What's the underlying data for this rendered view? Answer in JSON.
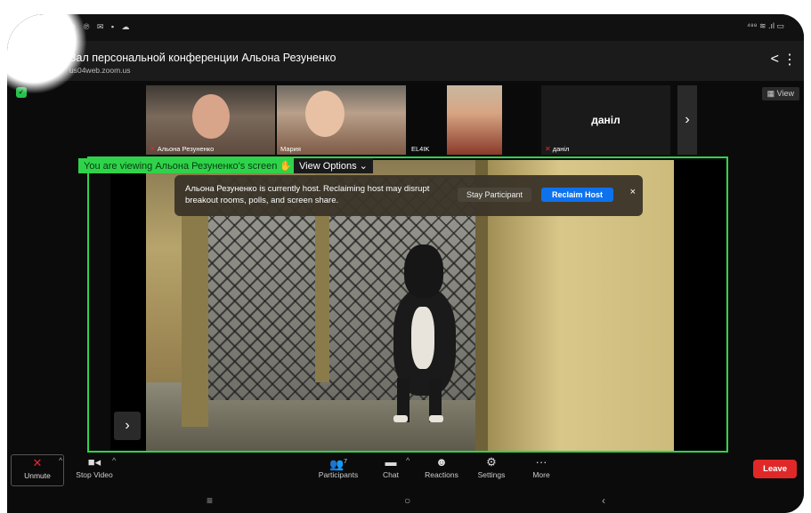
{
  "statusbar": {
    "left_icons": "• ⊙ ℗ ✉ ▪ ☁",
    "right_icons": "⁴⁸⁸ ≋ .ıl ▭"
  },
  "appbar": {
    "title": "Зал персональной конференции Альона Резуненко",
    "url": "us04web.zoom.us",
    "back_glyph": "←",
    "lock_glyph": "🔒",
    "share_glyph": "<",
    "more_glyph": "⋮"
  },
  "view_button": "View",
  "participants": [
    {
      "name": "Альона Резуненко",
      "muted": true
    },
    {
      "name": "Мария",
      "muted": false
    },
    {
      "name": "EL4IK",
      "muted": false
    },
    {
      "name": "даніл",
      "muted": true,
      "big_label": "даніл"
    }
  ],
  "share": {
    "viewing_text": "You are viewing Альона Резуненко's screen",
    "view_options": "View Options ⌄"
  },
  "banner": {
    "message": "Альона Резуненко is currently host. Reclaiming host may disrupt breakout rooms, polls, and screen share.",
    "stay_label": "Stay Participant",
    "reclaim_label": "Reclaim Host",
    "close_glyph": "×"
  },
  "toolbar": {
    "unmute": "Unmute",
    "stop_video": "Stop Video",
    "participants": "Participants",
    "participants_count": "7",
    "chat": "Chat",
    "reactions": "Reactions",
    "settings": "Settings",
    "more": "More",
    "leave": "Leave"
  },
  "navbar": {
    "menu": "≡",
    "home": "○",
    "back": "‹"
  },
  "colors": {
    "accent_green": "#2fd34a",
    "reclaim_blue": "#0e72ed",
    "leave_red": "#e02828"
  }
}
